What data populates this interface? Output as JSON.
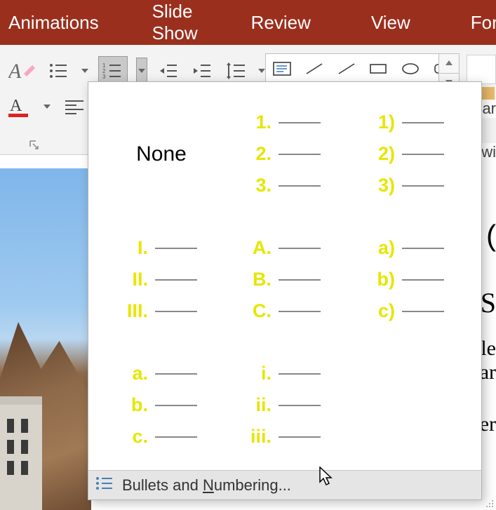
{
  "tabs": {
    "animations": "Animations",
    "slideshow": "Slide Show",
    "review": "Review",
    "view": "View",
    "format": "Format"
  },
  "numbering": {
    "none_label": "None",
    "styles": [
      {
        "id": "arabic-period",
        "items": [
          "1.",
          "2.",
          "3."
        ]
      },
      {
        "id": "arabic-paren",
        "items": [
          "1)",
          "2)",
          "3)"
        ]
      },
      {
        "id": "upper-roman",
        "items": [
          "I.",
          "II.",
          "III."
        ]
      },
      {
        "id": "upper-alpha",
        "items": [
          "A.",
          "B.",
          "C."
        ]
      },
      {
        "id": "lower-alpha-paren",
        "items": [
          "a)",
          "b)",
          "c)"
        ]
      },
      {
        "id": "lower-alpha-period",
        "items": [
          "a.",
          "b.",
          "c."
        ]
      },
      {
        "id": "lower-roman",
        "items": [
          "i.",
          "ii.",
          "iii."
        ]
      }
    ],
    "footer_label": "Bullets and Numbering..."
  },
  "right_fragments": {
    "f1": "ar",
    "f2": "wi",
    "f3": "(",
    "f4": "S",
    "f5": "le",
    "f6": "ar",
    "f7": "er"
  }
}
